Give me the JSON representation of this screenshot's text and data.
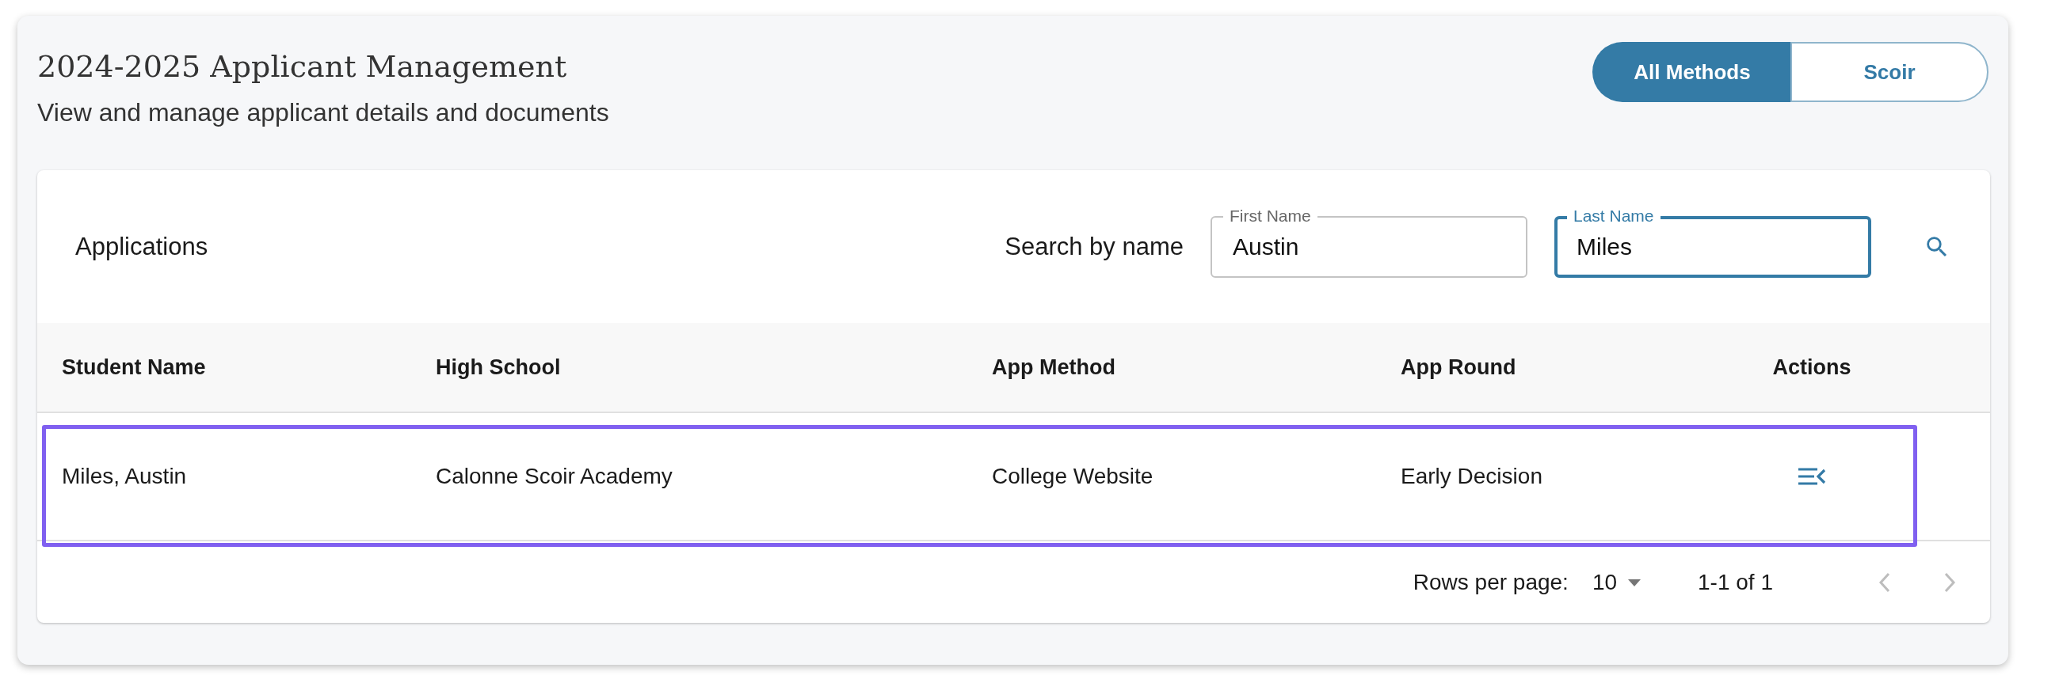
{
  "header": {
    "title": "2024-2025 Applicant Management",
    "subtitle": "View and manage applicant details and documents"
  },
  "method_toggle": [
    {
      "label": "All Methods",
      "selected": true
    },
    {
      "label": "Scoir",
      "selected": false
    }
  ],
  "card": {
    "title": "Applications",
    "search_label": "Search by name",
    "fields": [
      {
        "label": "First Name",
        "value": "Austin",
        "focused": false
      },
      {
        "label": "Last Name",
        "value": "Miles",
        "focused": true
      }
    ]
  },
  "table": {
    "columns": [
      "Student Name",
      "High School",
      "App Method",
      "App Round",
      "Actions"
    ],
    "rows": [
      {
        "cells": [
          "Miles, Austin",
          "Calonne Scoir Academy",
          "College Website",
          "Early Decision"
        ],
        "highlighted": true
      }
    ]
  },
  "pagination": {
    "rows_per_page_label": "Rows per page:",
    "rows_per_page": "10",
    "range": "1-1 of 1"
  }
}
